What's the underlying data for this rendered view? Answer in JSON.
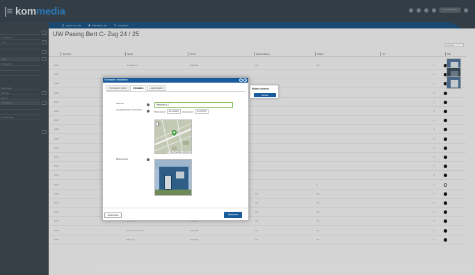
{
  "app": {
    "logo_bar": "|",
    "logo_dark": "≡",
    "logo_main": " kom",
    "logo_accent": "media",
    "user_account": "● Kontoinhaber"
  },
  "actions": [
    {
      "icon": "❮",
      "label": "zurück zur Liste"
    },
    {
      "icon": "✚",
      "label": "Fahrstellen neu"
    },
    {
      "icon": "✎",
      "label": "bearbeiten"
    }
  ],
  "sidebar": {
    "items": [
      "",
      "Verwaltung",
      "Liste",
      "",
      "Karte",
      "Fahrstellen",
      "",
      "",
      "Meldungen",
      "Berichte",
      "Export",
      "Verwaltung",
      "",
      "",
      "Einstellungen"
    ]
  },
  "page": {
    "title": "UW Pasing Bert C- Zug 24 / 25",
    "search_placeholder": "Suchen"
  },
  "table": {
    "columns": [
      "Nummer",
      "Name",
      "Strom",
      "Messzeitraum",
      "Status",
      "Ist",
      "Bild"
    ],
    "rows": [
      {
        "num": "0001",
        "name": "Hirschau 4.2",
        "type": "Standard",
        "val": "0,0",
        "status": "OK",
        "ist": "0",
        "dot": "filled",
        "thumb": "blue"
      },
      {
        "num": "0002",
        "name": "",
        "type": "",
        "val": "",
        "status": "",
        "ist": "0",
        "dot": "filled",
        "thumb": "dark"
      },
      {
        "num": "0003",
        "name": "",
        "type": "",
        "val": "",
        "status": "",
        "ist": "0",
        "dot": "filled",
        "thumb": "blue"
      },
      {
        "num": "0004",
        "name": "",
        "type": "",
        "val": "",
        "status": "",
        "ist": "0",
        "dot": "filled",
        "thumb": ""
      },
      {
        "num": "0005",
        "name": "",
        "type": "",
        "val": "",
        "status": "",
        "ist": "0",
        "dot": "filled",
        "thumb": ""
      },
      {
        "num": "0006",
        "name": "",
        "type": "",
        "val": "",
        "status": "",
        "ist": "0",
        "dot": "filled",
        "thumb": ""
      },
      {
        "num": "0007",
        "name": "",
        "type": "",
        "val": "",
        "status": "",
        "ist": "0",
        "dot": "filled",
        "thumb": ""
      },
      {
        "num": "0008",
        "name": "",
        "type": "",
        "val": "",
        "status": "",
        "ist": "0",
        "dot": "filled",
        "thumb": ""
      },
      {
        "num": "0009",
        "name": "",
        "type": "",
        "val": "",
        "status": "",
        "ist": "0",
        "dot": "filled",
        "thumb": ""
      },
      {
        "num": "0010",
        "name": "",
        "type": "",
        "val": "",
        "status": "",
        "ist": "0",
        "dot": "filled",
        "thumb": ""
      },
      {
        "num": "0011",
        "name": "",
        "type": "",
        "val": "",
        "status": "",
        "ist": "0",
        "dot": "filled",
        "thumb": ""
      },
      {
        "num": "0012",
        "name": "",
        "type": "",
        "val": "",
        "status": "",
        "ist": "0",
        "dot": "filled",
        "thumb": ""
      },
      {
        "num": "0013",
        "name": "",
        "type": "",
        "val": "",
        "status": "",
        "ist": "0",
        "dot": "filled",
        "thumb": ""
      },
      {
        "num": "0014",
        "name": "",
        "type": "",
        "val": "",
        "status": "0",
        "ist": "0",
        "dot": "ring",
        "thumb": ""
      },
      {
        "num": "0015",
        "name": "Hirschauer Str.",
        "type": "Haus",
        "val": "0,0",
        "status": "OK",
        "ist": "0",
        "dot": "filled",
        "thumb": ""
      },
      {
        "num": "0016",
        "name": "Fortuna Stadt 1",
        "type": "Standard",
        "val": "0,0",
        "status": "OK",
        "ist": "0",
        "dot": "filled",
        "thumb": ""
      },
      {
        "num": "0017",
        "name": "Fortuna Stadt 12",
        "type": "Standard",
        "val": "0,0",
        "status": "OK",
        "ist": "0",
        "dot": "filled",
        "thumb": ""
      },
      {
        "num": "0018",
        "name": "Bahnhof 11",
        "type": "Standard",
        "val": "0,0",
        "status": "OK",
        "ist": "0",
        "dot": "filled",
        "thumb": ""
      },
      {
        "num": "0019",
        "name": "Gewerbe Nord 1.0",
        "type": "Standard",
        "val": "0,0",
        "status": "OK",
        "ist": "0",
        "dot": "filled",
        "thumb": ""
      },
      {
        "num": "0020",
        "name": "Bahn 12",
        "type": "Standard",
        "val": "0,0",
        "status": "OK",
        "ist": "0",
        "dot": "filled",
        "thumb": ""
      }
    ]
  },
  "modal": {
    "title": "Fahrstellen bearbeiten",
    "tabs": [
      "Technische Daten",
      "Ortsdaten",
      "Links/Dateien"
    ],
    "active_tab": 1,
    "fields": {
      "address_label": "Adresse",
      "address_value": "Hirschau 4.2",
      "geo_label": "Geographische Koordinaten",
      "lat_label": "Breitengrad",
      "lat_value": "48.140350",
      "lng_label": "Längengrad",
      "lng_value": "11.495785",
      "map_credit": "© OpenStreetMap contributors",
      "photo_label": "Bildvorschau"
    },
    "cancel_label": "Abbrechen",
    "save_label": "Speichern"
  },
  "popover": {
    "title": "Weitere Adresse",
    "button_label": "Suchen"
  },
  "colors": {
    "topbar": "#38434c",
    "subbar": "#1c4f7a",
    "accent": "#1a5b9c",
    "input_ok": "#7fb94f"
  }
}
